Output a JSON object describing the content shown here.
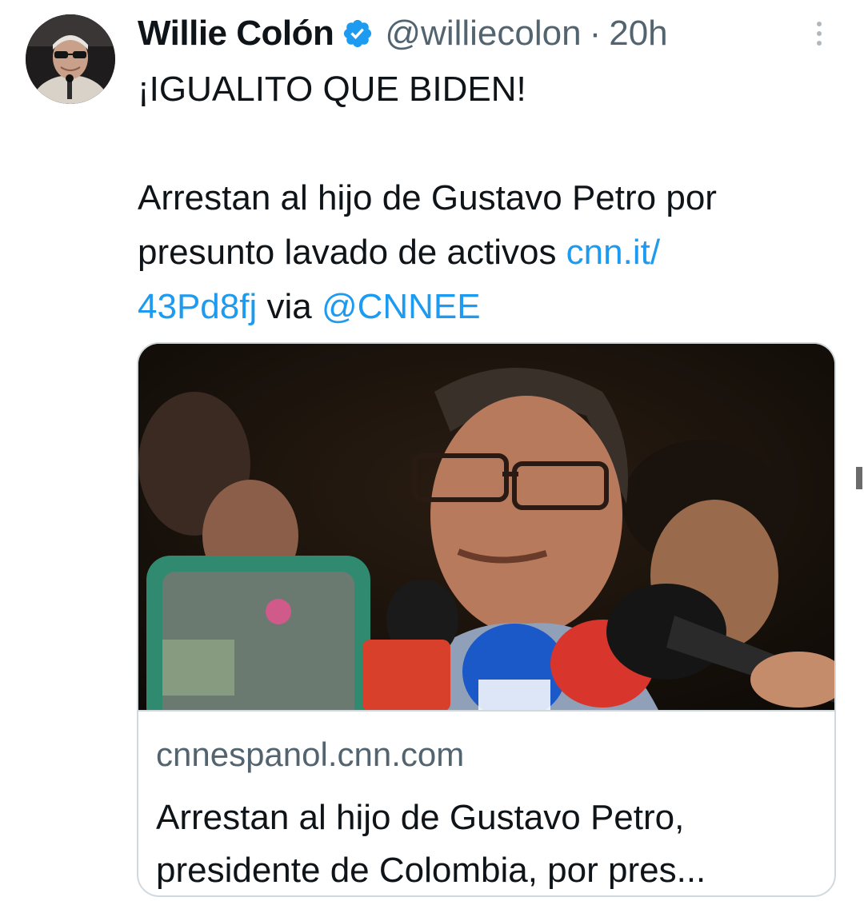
{
  "author": {
    "display_name": "Willie Colón",
    "handle": "@williecolon",
    "separator": "·",
    "time": "20h",
    "verified_icon": "verified-badge-icon",
    "more_icon": "more-vertical-icon"
  },
  "tweet": {
    "line1": "¡IGUALITO QUE BIDEN!",
    "body_prefix": "Arrestan al hijo de Gustavo Petro por presunto lavado de activos ",
    "link_part1": "cnn.it/",
    "link_part2": "43Pd8fj",
    "via": " via ",
    "mention": "@CNNEE"
  },
  "card": {
    "domain": "cnnespanol.cnn.com",
    "title_line1": "Arrestan al hijo de Gustavo Petro,",
    "title_line2": "presidente de Colombia, por pres..."
  },
  "colors": {
    "link": "#1d9bf0",
    "verified": "#1d9bf0",
    "secondary_text": "#536471",
    "card_border": "#cfd9de"
  }
}
